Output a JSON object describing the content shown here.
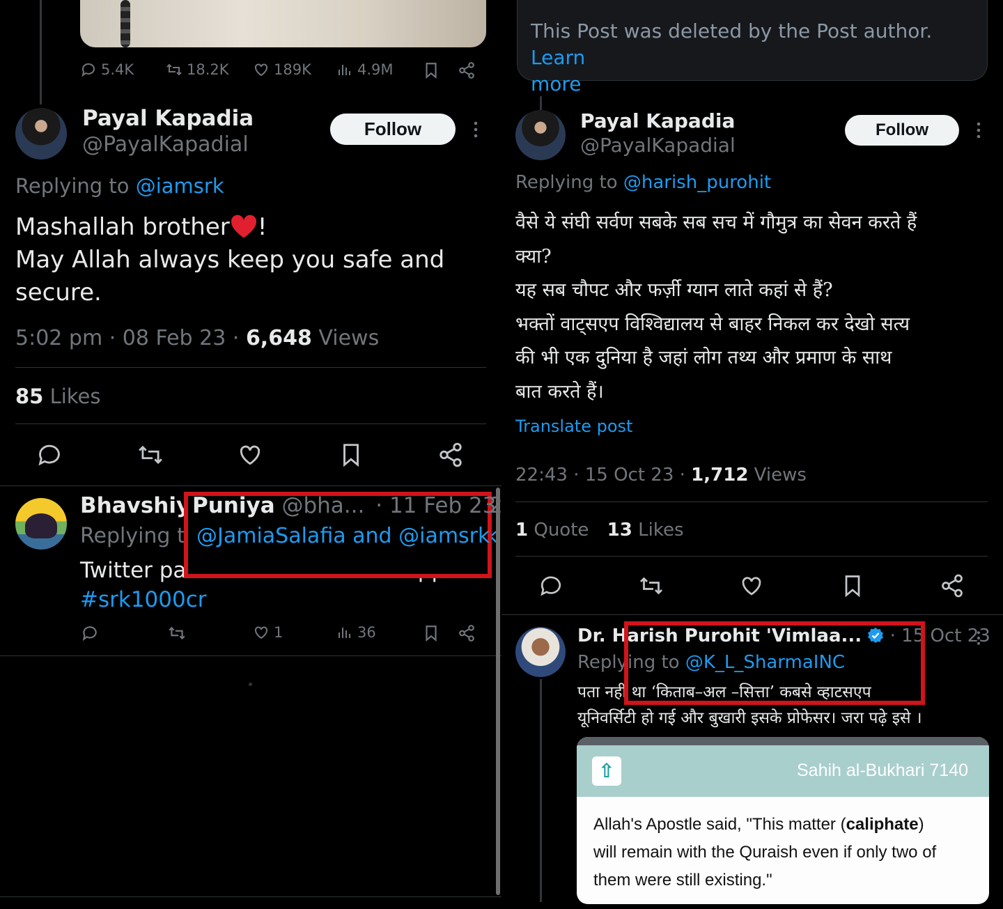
{
  "left": {
    "top_stats": {
      "replies": "5.4K",
      "reposts": "18.2K",
      "likes": "189K",
      "views": "4.9M"
    },
    "main_post": {
      "author_name": "Payal Kapadia",
      "author_handle": "@PayalKapadial",
      "follow_label": "Follow",
      "replying_prefix": "Replying to",
      "replying_to": "@iamsrk",
      "text_line1": "Mashallah brother",
      "text_line1_end": "!",
      "text_line2": "May Allah always keep you safe and",
      "text_line3": "secure.",
      "timestamp": "5:02 pm · 08 Feb 23 · ",
      "views_count": "6,648",
      "views_label": " Views",
      "likes_count": "85",
      "likes_label": " Likes"
    },
    "reply": {
      "author_name": "Bhavshiya Puniya",
      "author_handle": "@bha...",
      "date": "· 11 Feb 23",
      "replying_prefix": "Replying to",
      "replying_to": "@JamiaSalafia and @iamsrk",
      "text": "Twitter par trend chalate hai support",
      "hashtag": "#srk1000cr",
      "likes": "1",
      "views": "36"
    }
  },
  "right": {
    "deleted_notice": {
      "text": "This Post was deleted by the Post author.",
      "link_part1": "Learn",
      "link_part2": "more"
    },
    "main_post": {
      "author_name": "Payal Kapadia",
      "author_handle": "@PayalKapadial",
      "follow_label": "Follow",
      "replying_prefix": "Replying to",
      "replying_to": "@harish_purohit",
      "lines": [
        "वैसे ये संघी सर्वण सबके सब सच में गौमुत्र का सेवन करते हैं",
        "क्या?",
        "यह सब चौपट और फर्ज़ी  ग्यान  लाते कहां से हैं?",
        "भक्तों वाट्सएप विश्विद्यालय से बाहर निकल कर देखो सत्य",
        "की भी एक दुनिया है जहां लोग तथ्य और प्रमाण के साथ",
        "बात करते हैं।"
      ],
      "translate_label": "Translate post",
      "timestamp": "22:43 · 15 Oct 23 · ",
      "views_count": "1,712",
      "views_label": " Views",
      "quotes_count": "1",
      "quotes_label": " Quote",
      "likes_count": "13",
      "likes_label": " Likes"
    },
    "reply": {
      "author_name": "Dr. Harish Purohit 'Vimlaa...",
      "date": "· 15 Oct 23",
      "replying_prefix": "Replying to",
      "replying_to": "@K_L_SharmaINC",
      "line1": "पता नहीं था ‘किताब–अल –सित्ता’ कबसे व्हाटसएप",
      "line2": "यूनिवर्सिटी हो गई और बुखारी इसके प्रोफेसर। जरा पढ़े इसे ।",
      "card": {
        "header_title": "Sahih al-Bukhari 7140",
        "quote_part1": "Allah's Apostle said, \"This matter (",
        "quote_bold": "caliphate",
        "quote_part2": ")",
        "quote_line2": "will remain with the Quraish even if only two of",
        "quote_line3": "them were still existing.\""
      }
    }
  },
  "colors": {
    "background": "#000000",
    "text": "#e7e9ea",
    "muted": "#71767b",
    "link": "#1d9bf0",
    "divider": "#2f3336",
    "highlight_box": "#d0141a",
    "heart": "#f91880"
  },
  "icons": [
    "reply-icon",
    "repost-icon",
    "like-icon",
    "views-icon",
    "bookmark-icon",
    "share-icon",
    "more-icon",
    "heart-emoji-icon",
    "verified-badge-icon",
    "scroll-up-icon"
  ]
}
